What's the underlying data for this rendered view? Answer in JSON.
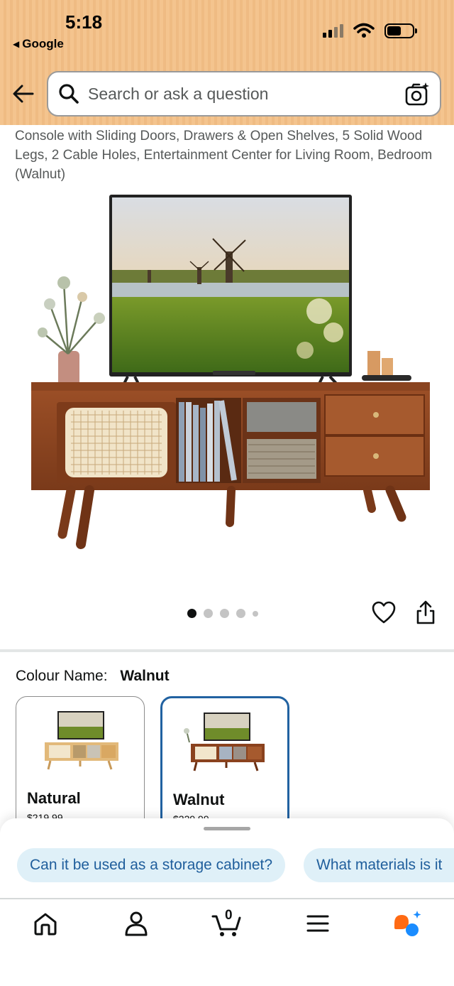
{
  "status_bar": {
    "time": "5:18",
    "back_app": "Google",
    "back_icon": "caret-left-icon",
    "signal_icon": "cellular-signal-icon",
    "wifi_icon": "wifi-icon",
    "battery_icon": "battery-icon"
  },
  "search": {
    "placeholder": "Search or ask a question",
    "search_icon": "search-icon",
    "camera_icon": "camera-search-icon",
    "back_icon": "back-arrow-icon"
  },
  "product": {
    "title": "Console with Sliding Doors, Drawers & Open Shelves, 5 Solid Wood Legs, 2 Cable Holes, Entertainment Center for Living Room, Bedroom (Walnut)",
    "image_count": 5,
    "active_image": 1
  },
  "actions": {
    "wishlist_icon": "heart-icon",
    "share_icon": "share-icon"
  },
  "variation": {
    "label": "Colour Name:",
    "selected": "Walnut",
    "options": [
      {
        "name": "Natural",
        "price": "$219.99",
        "selected": false
      },
      {
        "name": "Walnut",
        "price": "$229.99",
        "selected": true
      }
    ]
  },
  "suggestions": {
    "chips": [
      "Can it be used as a storage cabinet?",
      "What materials is it"
    ]
  },
  "bottom_nav": {
    "cart_count": "0",
    "items": [
      {
        "icon": "home-icon"
      },
      {
        "icon": "account-icon"
      },
      {
        "icon": "cart-icon"
      },
      {
        "icon": "menu-icon"
      },
      {
        "icon": "rufus-assistant-icon"
      }
    ]
  },
  "colors": {
    "header_bg": "#f4c48e",
    "link_blue": "#2162a1",
    "chip_bg": "#dff0f8",
    "chip_text": "#1f5e9c",
    "assistant_orange": "#ff6a13",
    "assistant_blue": "#1a8cff"
  }
}
